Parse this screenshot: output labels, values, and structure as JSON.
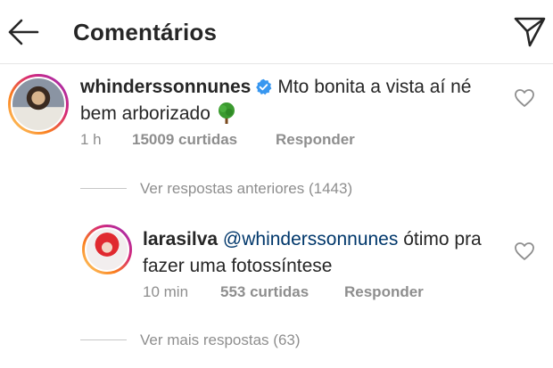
{
  "header": {
    "title": "Comentários",
    "back_icon": "arrow-left-icon",
    "share_icon": "paper-plane-icon"
  },
  "comments": [
    {
      "username": "whinderssonnunes",
      "verified": true,
      "text": "Mto bonita a vista aí né bem arborizado",
      "emoji": "tree-emoji",
      "time": "1 h",
      "likes": "15009 curtidas",
      "reply": "Responder"
    },
    {
      "username": "larasilva",
      "mention": "@whinderssonnunes",
      "text": "ótimo pra fazer uma fotossíntese",
      "time": "10 min",
      "likes": "553 curtidas",
      "reply": "Responder"
    }
  ],
  "threads": {
    "previous": "Ver respostas anteriores (1443)",
    "more": "Ver mais respostas (63)"
  },
  "colors": {
    "text": "#262626",
    "secondary": "#8e8e8e",
    "mention": "#00376b",
    "verified": "#3897f0"
  }
}
